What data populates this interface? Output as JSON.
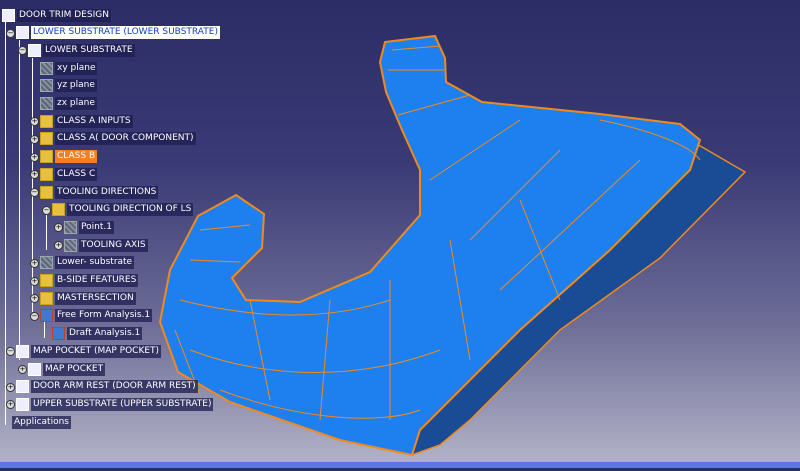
{
  "tree": [
    {
      "label": "DOOR TRIM DESIGN",
      "depth": 0,
      "icon": "product-icon",
      "toggle": ""
    },
    {
      "label": "LOWER SUBSTRATE (LOWER SUBSTRATE)",
      "depth": 1,
      "icon": "product-icon",
      "toggle": "-",
      "state": "selected"
    },
    {
      "label": "LOWER SUBSTRATE",
      "depth": 2,
      "icon": "part-icon",
      "toggle": "-"
    },
    {
      "label": "xy plane",
      "depth": 3,
      "icon": "plane-icon",
      "toggle": ""
    },
    {
      "label": "yz plane",
      "depth": 3,
      "icon": "plane-icon",
      "toggle": ""
    },
    {
      "label": "zx plane",
      "depth": 3,
      "icon": "plane-icon",
      "toggle": ""
    },
    {
      "label": "CLASS A INPUTS",
      "depth": 3,
      "icon": "geometrical-set-icon",
      "toggle": "+"
    },
    {
      "label": "CLASS A( DOOR COMPONENT)",
      "depth": 3,
      "icon": "geometrical-set-icon",
      "toggle": "+"
    },
    {
      "label": "CLASS B",
      "depth": 3,
      "icon": "geometrical-set-icon",
      "toggle": "+",
      "state": "highlighted"
    },
    {
      "label": "CLASS C",
      "depth": 3,
      "icon": "geometrical-set-icon",
      "toggle": "+"
    },
    {
      "label": "TOOLING DIRECTIONS",
      "depth": 3,
      "icon": "geometrical-set-icon",
      "toggle": "-"
    },
    {
      "label": "TOOLING DIRECTION OF LS",
      "depth": 4,
      "icon": "geometrical-set-icon",
      "toggle": "-"
    },
    {
      "label": "Point.1",
      "depth": 5,
      "icon": "point-icon",
      "toggle": "+"
    },
    {
      "label": "TOOLING AXIS",
      "depth": 5,
      "icon": "line-icon",
      "toggle": "+"
    },
    {
      "label": "Lower- substrate",
      "depth": 3,
      "icon": "body-icon",
      "toggle": "+"
    },
    {
      "label": "B-SIDE FEATURES",
      "depth": 3,
      "icon": "geometrical-set-icon",
      "toggle": "+"
    },
    {
      "label": "MASTERSECTION",
      "depth": 3,
      "icon": "geometrical-set-icon",
      "toggle": "+"
    },
    {
      "label": "Free Form Analysis.1",
      "depth": 3,
      "icon": "analysis-icon",
      "toggle": "-"
    },
    {
      "label": "Draft Analysis.1",
      "depth": 4,
      "icon": "draft-analysis-icon",
      "toggle": ""
    },
    {
      "label": "MAP POCKET (MAP POCKET)",
      "depth": 1,
      "icon": "product-icon",
      "toggle": "-"
    },
    {
      "label": "MAP POCKET",
      "depth": 2,
      "icon": "part-icon",
      "toggle": "+"
    },
    {
      "label": "DOOR ARM REST (DOOR ARM REST)",
      "depth": 1,
      "icon": "product-icon",
      "toggle": "+"
    },
    {
      "label": "UPPER SUBSTRATE (UPPER SUBSTRATE)",
      "depth": 1,
      "icon": "product-icon",
      "toggle": "+"
    },
    {
      "label": "Applications",
      "depth": 0,
      "icon": "",
      "toggle": ""
    }
  ],
  "colors": {
    "surface": "#1e80ee",
    "surface_dark": "#1a4c96",
    "edges": "#f08a1c",
    "selection": "#f08020"
  }
}
